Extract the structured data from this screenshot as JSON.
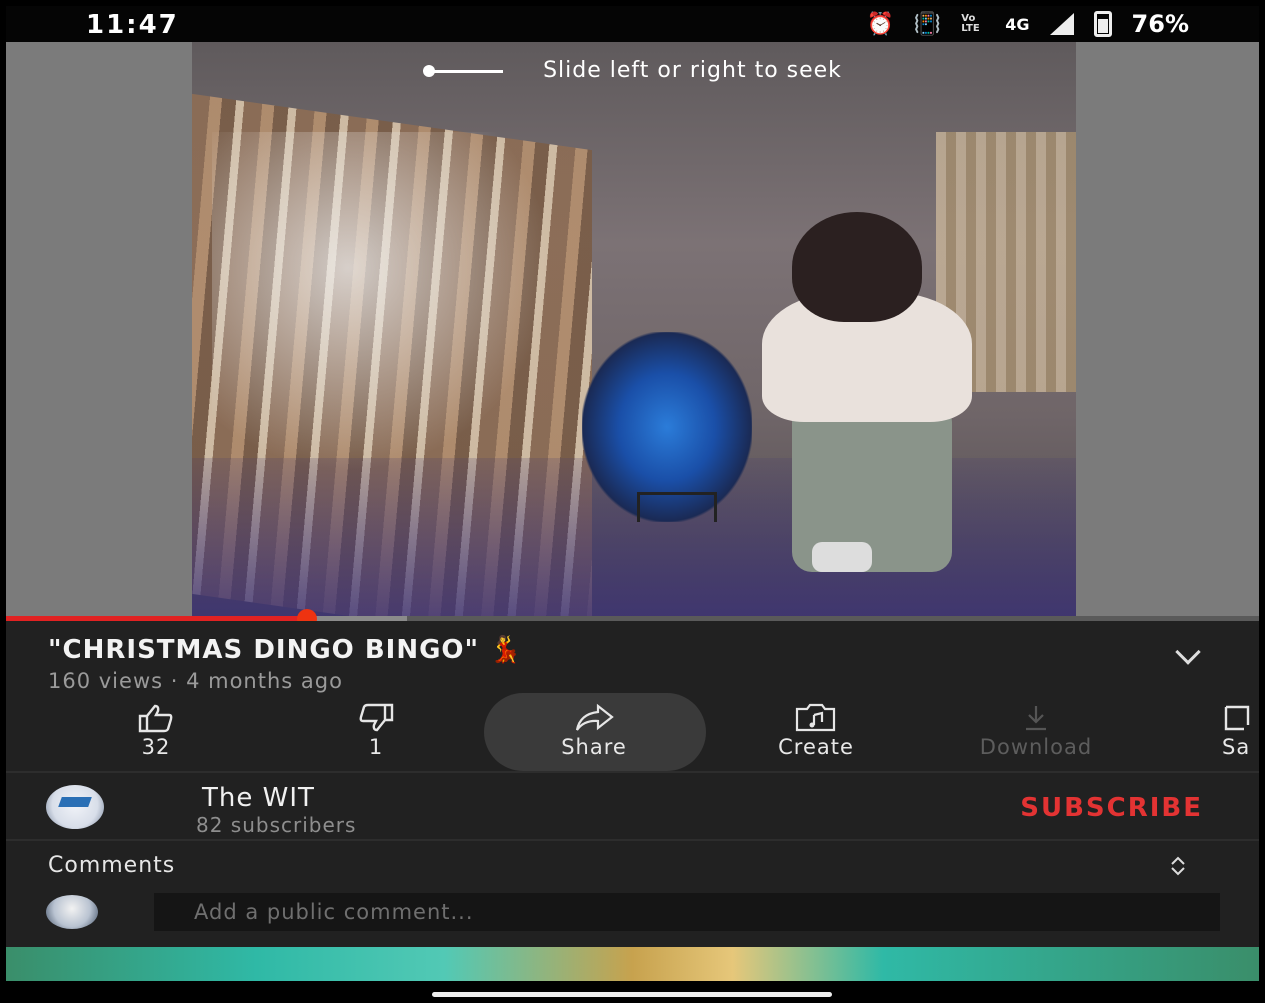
{
  "status_bar": {
    "time": "11:47",
    "network": "4G",
    "volte": "Vo LTE",
    "battery": "76%"
  },
  "player": {
    "seek_hint": "Slide left or right to seek",
    "progress_fraction": 0.24,
    "buffered_fraction": 0.32,
    "progress_color": "#e22222"
  },
  "video": {
    "title": "\"CHRISTMAS DINGO BINGO\"",
    "title_emoji": "💃",
    "meta": "160 views · 4 months ago"
  },
  "actions": {
    "like_count": "32",
    "dislike_count": "1",
    "share_label": "Share",
    "create_label": "Create",
    "download_label": "Download",
    "save_label": "Sa"
  },
  "channel": {
    "name": "The WIT",
    "subscribers": "82 subscribers",
    "subscribe_label": "SUBSCRIBE",
    "accent": "#e33333"
  },
  "comments": {
    "title": "Comments",
    "placeholder": "Add a public comment..."
  }
}
